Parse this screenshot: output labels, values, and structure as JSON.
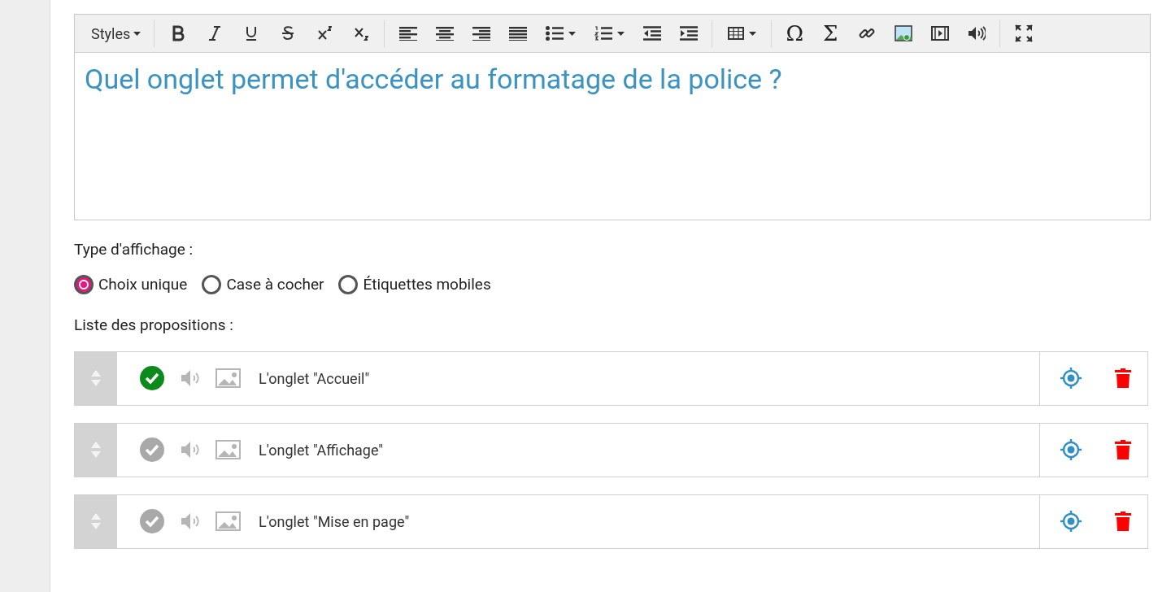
{
  "editor": {
    "toolbar": [
      {
        "kind": "styles",
        "label": "Styles"
      },
      {
        "kind": "sep"
      },
      {
        "kind": "bold"
      },
      {
        "kind": "italic"
      },
      {
        "kind": "underline"
      },
      {
        "kind": "strike"
      },
      {
        "kind": "superscript"
      },
      {
        "kind": "subscript"
      },
      {
        "kind": "sep"
      },
      {
        "kind": "align-left"
      },
      {
        "kind": "align-center"
      },
      {
        "kind": "align-right"
      },
      {
        "kind": "justify"
      },
      {
        "kind": "bullets"
      },
      {
        "kind": "numbers"
      },
      {
        "kind": "outdent"
      },
      {
        "kind": "indent"
      },
      {
        "kind": "sep"
      },
      {
        "kind": "table"
      },
      {
        "kind": "sep"
      },
      {
        "kind": "symbol",
        "label": "Ω"
      },
      {
        "kind": "symbol",
        "label": "Σ"
      },
      {
        "kind": "link"
      },
      {
        "kind": "image"
      },
      {
        "kind": "video"
      },
      {
        "kind": "audio"
      },
      {
        "kind": "sep"
      },
      {
        "kind": "fullscreen"
      }
    ],
    "content": "Quel onglet permet d'accéder au formatage de la police ?"
  },
  "display_type": {
    "label": "Type d'affichage :",
    "options": [
      {
        "label": "Choix unique",
        "selected": true
      },
      {
        "label": "Case à cocher",
        "selected": false
      },
      {
        "label": "Étiquettes mobiles",
        "selected": false
      }
    ]
  },
  "propositions": {
    "label": "Liste des propositions :",
    "items": [
      {
        "text": "L'onglet \"Accueil\"",
        "correct": true
      },
      {
        "text": "L'onglet \"Affichage\"",
        "correct": false
      },
      {
        "text": "L'onglet \"Mise en page\"",
        "correct": false
      }
    ]
  }
}
